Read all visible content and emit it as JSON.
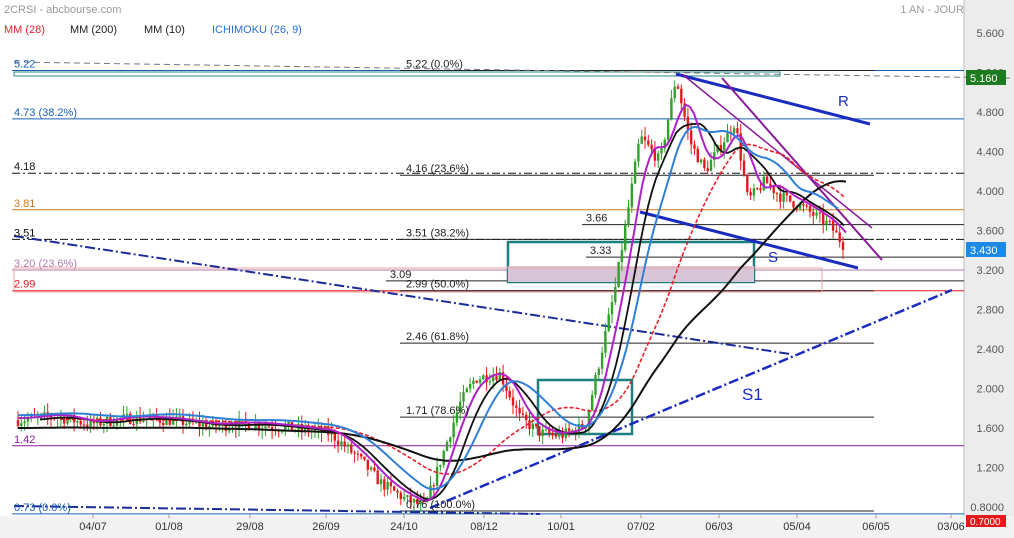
{
  "header": {
    "symbol": "2CRSI - abcbourse.com",
    "period": "1 AN - JOUR",
    "indicators": [
      {
        "label": "MM (28)",
        "color": "#e8202a"
      },
      {
        "label": "MM (200)",
        "color": "#222222"
      },
      {
        "label": "MM (10)",
        "color": "#222222"
      },
      {
        "label": "ICHIMOKU (26, 9)",
        "color": "#2a6fd6"
      }
    ]
  },
  "colors": {
    "candle_up": "#33a02c",
    "candle_down": "#e31a1c",
    "mm28": "#e8202a",
    "mm200": "#111111",
    "mm10": "#111111",
    "tenkan": "#b020c8",
    "kijun": "#2f7fd6",
    "trend_blue": "#1a2cc0",
    "trend_purple": "#8a1a9a",
    "fib_line": "#222222",
    "price_badge": "#1e7a1e",
    "last_badge": "#1e88e5"
  },
  "chart_data": {
    "type": "candlestick",
    "title": "2CRSI",
    "x_tick_labels": [
      "04/07",
      "01/08",
      "29/08",
      "26/09",
      "24/10",
      "08/12",
      "10/01",
      "07/02",
      "06/03",
      "05/04",
      "06/05",
      "03/06"
    ],
    "ylim": [
      0.7,
      5.75
    ],
    "y_tick_labels": [
      "5.600",
      "5.200",
      "4.800",
      "4.400",
      "4.000",
      "3.600",
      "3.200",
      "2.800",
      "2.400",
      "2.000",
      "1.600",
      "1.200",
      "0.8000"
    ],
    "current_price": "5.160",
    "last_price": "3.430",
    "low_badge": "0.7000",
    "left_levels": [
      {
        "label": "5.22",
        "value": 5.22,
        "color": "#1a5fb4",
        "style": "solid"
      },
      {
        "label": "4.73  (38.2%)",
        "value": 4.73,
        "color": "#1a5fb4",
        "style": "solid"
      },
      {
        "label": "4.18",
        "value": 4.18,
        "color": "#111111",
        "style": "dashdot"
      },
      {
        "label": "3.81",
        "value": 3.81,
        "color": "#d07a1a",
        "style": "solid"
      },
      {
        "label": "3.51",
        "value": 3.51,
        "color": "#111111",
        "style": "dashdot"
      },
      {
        "label": "3.20  (23.6%)",
        "value": 3.2,
        "color": "#b07ab0",
        "style": "solid"
      },
      {
        "label": "2.99",
        "value": 2.99,
        "color": "#e31a1c",
        "style": "solid"
      },
      {
        "label": "1.42",
        "value": 1.42,
        "color": "#8a1a9a",
        "style": "solid"
      },
      {
        "label": "0.73  (0.0%)",
        "value": 0.73,
        "color": "#1a5fb4",
        "style": "solid"
      }
    ],
    "fib_levels": [
      {
        "label": "5.22  (0.0%)",
        "value": 5.22
      },
      {
        "label": "4.16  (23.6%)",
        "value": 4.16
      },
      {
        "label": "3.51  (38.2%)",
        "value": 3.51
      },
      {
        "label": "2.99  (50.0%)",
        "value": 2.99
      },
      {
        "label": "2.46  (61.8%)",
        "value": 2.46
      },
      {
        "label": "1.71  (78.6%)",
        "value": 1.71
      },
      {
        "label": "0.76  (100.0%)",
        "value": 0.76
      }
    ],
    "extra_levels": [
      {
        "label": "3.66",
        "value": 3.66
      },
      {
        "label": "3.33",
        "value": 3.33
      },
      {
        "label": "3.09",
        "value": 3.09
      }
    ],
    "trend_labels": {
      "resistance": "R",
      "support": "S",
      "support1": "S1"
    }
  }
}
